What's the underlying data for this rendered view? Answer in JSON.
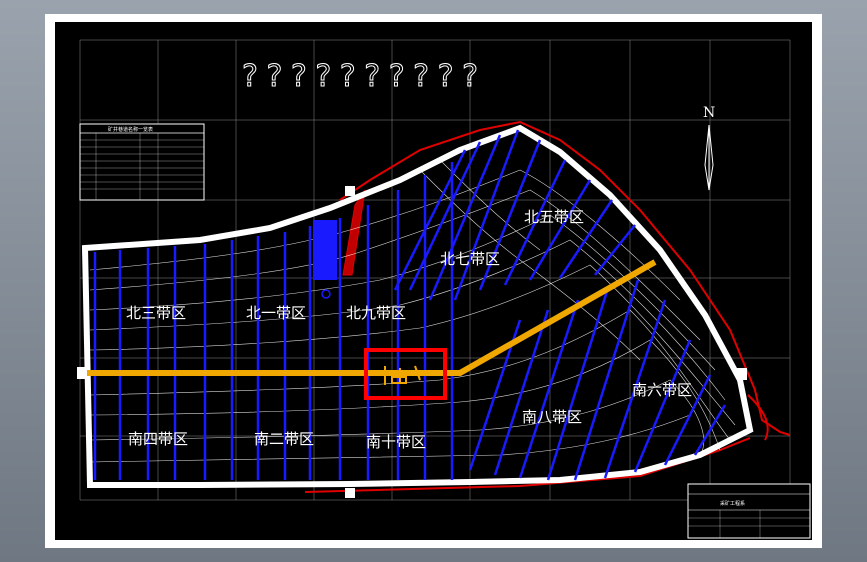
{
  "drawing": {
    "title_placeholder": "??????????",
    "north_label": "N",
    "legend_title": "矿井巷道名称一览表",
    "titleblock_name": "采矿工程系",
    "zones": [
      {
        "id": "north-5",
        "label": "北五带区"
      },
      {
        "id": "north-7",
        "label": "北七带区"
      },
      {
        "id": "north-3",
        "label": "北三带区"
      },
      {
        "id": "north-1",
        "label": "北一带区"
      },
      {
        "id": "north-9",
        "label": "北九带区"
      },
      {
        "id": "south-6",
        "label": "南六带区"
      },
      {
        "id": "south-8",
        "label": "南八带区"
      },
      {
        "id": "south-4",
        "label": "南四带区"
      },
      {
        "id": "south-2",
        "label": "南二带区"
      },
      {
        "id": "south-10",
        "label": "南十带区"
      }
    ]
  },
  "colors": {
    "background": "#000000",
    "panel_lines": "#1a1aff",
    "main_roadway": "#f0a800",
    "boundary": "#ffffff",
    "red_outline": "#e00000",
    "shaft_box": "#ff0000"
  }
}
